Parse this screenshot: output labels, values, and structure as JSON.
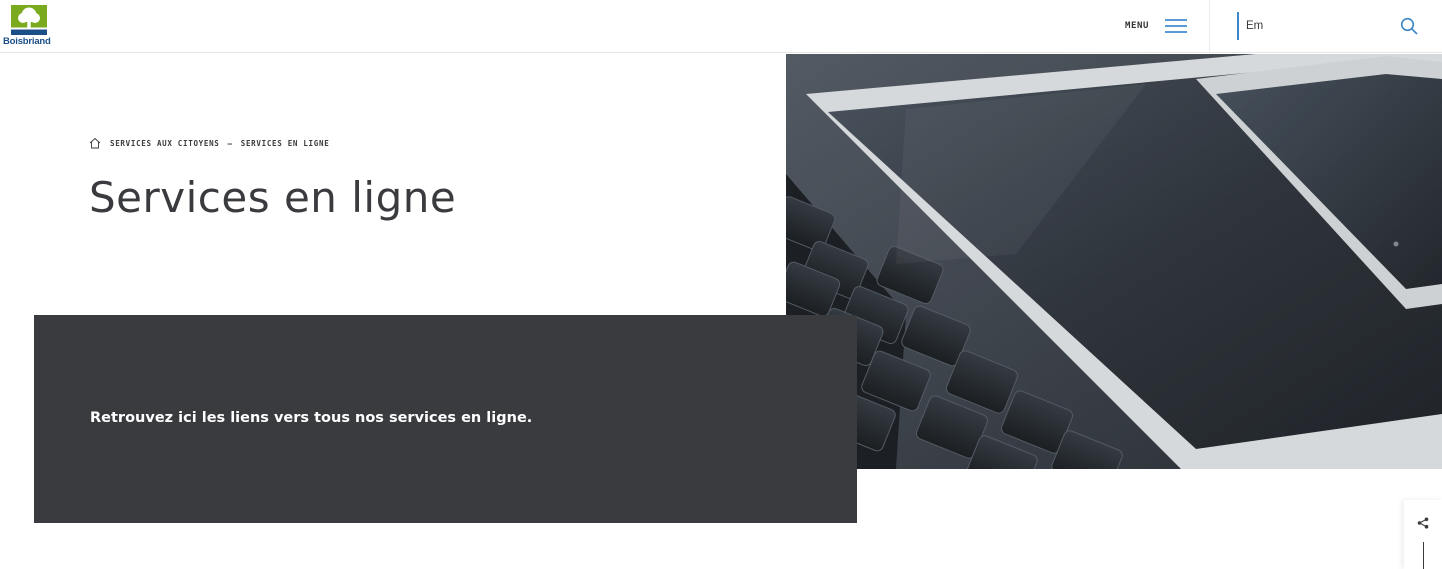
{
  "header": {
    "logo": {
      "wordmark": "Boisbriand",
      "icon": "tree-logo-icon"
    },
    "menu": {
      "label": "MENU",
      "icon": "hamburger-icon"
    },
    "search": {
      "value": "Em",
      "placeholder": "Em",
      "icon": "search-icon"
    }
  },
  "breadcrumb": {
    "icon": "home-icon",
    "items": [
      "SERVICES AUX CITOYENS",
      "SERVICES EN LIGNE"
    ],
    "separator": "–"
  },
  "page": {
    "title": "Services en ligne",
    "intro": "Retrouvez ici les liens vers tous nos services en ligne.",
    "hero_image": "keyboard-and-devices-photo"
  },
  "share": {
    "icon": "share-icon"
  },
  "colors": {
    "text": "#3a3b3e",
    "intro_box": "#3a3b3e",
    "accent_blue": "#3d86c8",
    "logo_green": "#7aaa1e",
    "logo_blue": "#1c4f87"
  }
}
